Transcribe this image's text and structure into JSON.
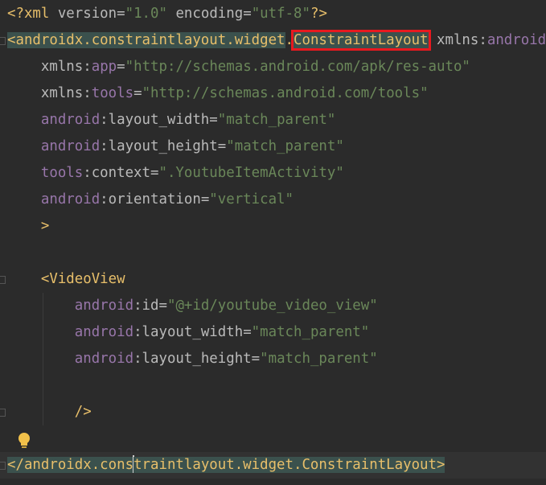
{
  "editor": {
    "lines": [
      {
        "segments": [
          {
            "t": "<?xml ",
            "c": "c-pi"
          },
          {
            "t": "version",
            "c": "c-attr"
          },
          {
            "t": "=",
            "c": "c-plain"
          },
          {
            "t": "\"1.0\"",
            "c": "c-str"
          },
          {
            "t": " ",
            "c": "c-plain"
          },
          {
            "t": "encoding",
            "c": "c-attr"
          },
          {
            "t": "=",
            "c": "c-plain"
          },
          {
            "t": "\"utf-8\"",
            "c": "c-str"
          },
          {
            "t": "?>",
            "c": "c-pi"
          }
        ]
      },
      {
        "segments": [
          {
            "t": "<androidx.constraintlayout.widget",
            "c": "c-tag tag-hl"
          },
          {
            "t": ".",
            "c": "c-tag"
          },
          {
            "t": "ConstraintLayout",
            "c": "c-tag red-box"
          },
          {
            "t": " ",
            "c": "c-plain"
          },
          {
            "t": "xmlns",
            "c": "c-attr"
          },
          {
            "t": ":",
            "c": "c-plain"
          },
          {
            "t": "android",
            "c": "c-ns"
          }
        ]
      },
      {
        "segments": [
          {
            "t": "    xmlns",
            "c": "c-attr"
          },
          {
            "t": ":",
            "c": "c-plain"
          },
          {
            "t": "app",
            "c": "c-ns"
          },
          {
            "t": "=",
            "c": "c-plain"
          },
          {
            "t": "\"http://schemas.android.com/apk/res-auto\"",
            "c": "c-str"
          }
        ]
      },
      {
        "segments": [
          {
            "t": "    xmlns",
            "c": "c-attr"
          },
          {
            "t": ":",
            "c": "c-plain"
          },
          {
            "t": "tools",
            "c": "c-ns"
          },
          {
            "t": "=",
            "c": "c-plain"
          },
          {
            "t": "\"http://schemas.android.com/tools\"",
            "c": "c-str"
          }
        ]
      },
      {
        "segments": [
          {
            "t": "    android",
            "c": "c-ns"
          },
          {
            "t": ":layout_width",
            "c": "c-attr"
          },
          {
            "t": "=",
            "c": "c-plain"
          },
          {
            "t": "\"match_parent\"",
            "c": "c-str"
          }
        ]
      },
      {
        "segments": [
          {
            "t": "    android",
            "c": "c-ns"
          },
          {
            "t": ":layout_height",
            "c": "c-attr"
          },
          {
            "t": "=",
            "c": "c-plain"
          },
          {
            "t": "\"match_parent\"",
            "c": "c-str"
          }
        ]
      },
      {
        "segments": [
          {
            "t": "    tools",
            "c": "c-ns"
          },
          {
            "t": ":context",
            "c": "c-attr"
          },
          {
            "t": "=",
            "c": "c-plain"
          },
          {
            "t": "\".YoutubeItemActivity\"",
            "c": "c-str"
          }
        ]
      },
      {
        "segments": [
          {
            "t": "    android",
            "c": "c-ns"
          },
          {
            "t": ":orientation",
            "c": "c-attr"
          },
          {
            "t": "=",
            "c": "c-plain"
          },
          {
            "t": "\"vertical\"",
            "c": "c-str"
          }
        ]
      },
      {
        "segments": [
          {
            "t": "    >",
            "c": "c-punct"
          }
        ]
      },
      {
        "segments": []
      },
      {
        "segments": [
          {
            "t": "    <VideoView",
            "c": "c-tag"
          }
        ]
      },
      {
        "segments": [
          {
            "t": "        android",
            "c": "c-ns"
          },
          {
            "t": ":id",
            "c": "c-attr"
          },
          {
            "t": "=",
            "c": "c-plain"
          },
          {
            "t": "\"@+id/youtube_video_view\"",
            "c": "c-str"
          }
        ]
      },
      {
        "segments": [
          {
            "t": "        android",
            "c": "c-ns"
          },
          {
            "t": ":layout_width",
            "c": "c-attr"
          },
          {
            "t": "=",
            "c": "c-plain"
          },
          {
            "t": "\"match_parent\"",
            "c": "c-str"
          }
        ]
      },
      {
        "segments": [
          {
            "t": "        android",
            "c": "c-ns"
          },
          {
            "t": ":layout_height",
            "c": "c-attr"
          },
          {
            "t": "=",
            "c": "c-plain"
          },
          {
            "t": "\"match_parent\"",
            "c": "c-str"
          }
        ]
      },
      {
        "segments": []
      },
      {
        "segments": [
          {
            "t": "        />",
            "c": "c-tag"
          }
        ]
      },
      {
        "segments": []
      },
      {
        "segments": [
          {
            "t": "</androidx.cons",
            "c": "c-tag tag-hl"
          },
          {
            "caret": true
          },
          {
            "t": "traintlayout.widget.ConstraintLayout>",
            "c": "c-tag tag-hl"
          }
        ],
        "current": true
      }
    ]
  },
  "icons": {
    "bulb": "lightbulb-icon"
  }
}
